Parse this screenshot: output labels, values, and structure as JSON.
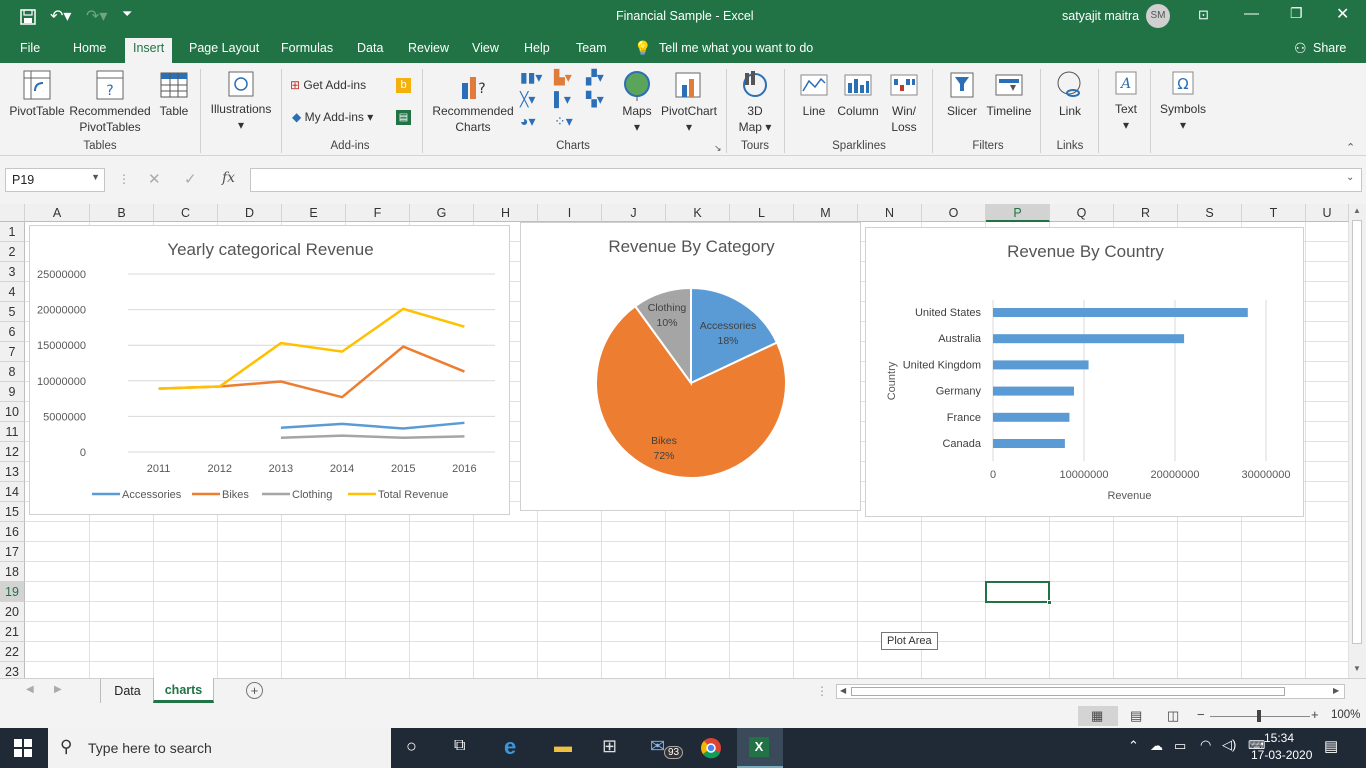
{
  "window": {
    "title": "Financial Sample  -  Excel",
    "user": "satyajit maitra",
    "user_initials": "SM"
  },
  "tabs": [
    "File",
    "Home",
    "Insert",
    "Page Layout",
    "Formulas",
    "Data",
    "Review",
    "View",
    "Help",
    "Team"
  ],
  "tell_me": "Tell me what you want to do",
  "share": "Share",
  "ribbon": {
    "pivottable": "PivotTable",
    "recommended_pivot": "Recommended",
    "recommended_pivot2": "PivotTables",
    "table": "Table",
    "illustrations": "Illustrations",
    "get_addins": "Get Add-ins",
    "my_addins": "My Add-ins",
    "recommended_charts": "Recommended",
    "recommended_charts2": "Charts",
    "maps": "Maps",
    "pivotchart": "PivotChart",
    "map3d": "3D",
    "map3d2": "Map",
    "line": "Line",
    "column": "Column",
    "winloss": "Win/",
    "winloss2": "Loss",
    "slicer": "Slicer",
    "timeline": "Timeline",
    "link": "Link",
    "text": "Text",
    "symbols": "Symbols",
    "groups": {
      "tables": "Tables",
      "addins": "Add-ins",
      "charts": "Charts",
      "tours": "Tours",
      "sparklines": "Sparklines",
      "filters": "Filters",
      "links": "Links"
    }
  },
  "formula_bar": {
    "name_box": "P19",
    "fx": "fx",
    "value": ""
  },
  "columns": [
    "A",
    "B",
    "C",
    "D",
    "E",
    "F",
    "G",
    "H",
    "I",
    "J",
    "K",
    "L",
    "M",
    "N",
    "O",
    "P",
    "Q",
    "R",
    "S",
    "T",
    "U"
  ],
  "rows": [
    "1",
    "2",
    "3",
    "4",
    "5",
    "6",
    "7",
    "8",
    "9",
    "10",
    "11",
    "12",
    "13",
    "14",
    "15",
    "16",
    "17",
    "18",
    "19",
    "20",
    "21",
    "22",
    "23"
  ],
  "selected_cell": "P19",
  "tooltip": "Plot Area",
  "sheets": [
    "Data",
    "charts"
  ],
  "active_sheet": "charts",
  "status": {
    "zoom": "100%"
  },
  "taskbar": {
    "search": "Type here to search",
    "time": "15:34",
    "date": "17-03-2020",
    "mail_badge": "93"
  },
  "colors": {
    "excel_green": "#217346",
    "accessories": "#5b9bd5",
    "bikes": "#ed7d31",
    "clothing": "#a5a5a5",
    "total": "#ffc000"
  },
  "chart_data": [
    {
      "type": "line",
      "title": "Yearly categorical Revenue",
      "x": [
        "2011",
        "2012",
        "2013",
        "2014",
        "2015",
        "2016"
      ],
      "ylim": [
        0,
        25000000
      ],
      "yticks": [
        "25000000",
        "20000000",
        "15000000",
        "10000000",
        "5000000",
        "0"
      ],
      "legend_position": "bottom",
      "series": [
        {
          "name": "Accessories",
          "values": [
            null,
            null,
            3400000,
            3950000,
            3300000,
            4100000
          ]
        },
        {
          "name": "Bikes",
          "values": [
            8900000,
            9200000,
            9900000,
            7700000,
            14800000,
            11300000
          ]
        },
        {
          "name": "Clothing",
          "values": [
            null,
            null,
            2000000,
            2300000,
            2000000,
            2200000
          ]
        },
        {
          "name": "Total Revenue",
          "values": [
            8900000,
            9200000,
            15300000,
            14100000,
            20100000,
            17600000
          ]
        }
      ]
    },
    {
      "type": "pie",
      "title": "Revenue By Category",
      "slices": [
        {
          "name": "Accessories",
          "pct": "18%",
          "value": 18
        },
        {
          "name": "Bikes",
          "pct": "72%",
          "value": 72
        },
        {
          "name": "Clothing",
          "pct": "10%",
          "value": 10
        }
      ]
    },
    {
      "type": "bar",
      "title": "Revenue By Country",
      "xlabel": "Revenue",
      "ylabel": "Country",
      "categories": [
        "United States",
        "Australia",
        "United Kingdom",
        "Germany",
        "France",
        "Canada"
      ],
      "values": [
        28000000,
        21000000,
        10500000,
        8900000,
        8400000,
        7900000
      ],
      "xlim": [
        0,
        30000000
      ],
      "xticks": [
        "0",
        "10000000",
        "20000000",
        "30000000"
      ]
    }
  ]
}
